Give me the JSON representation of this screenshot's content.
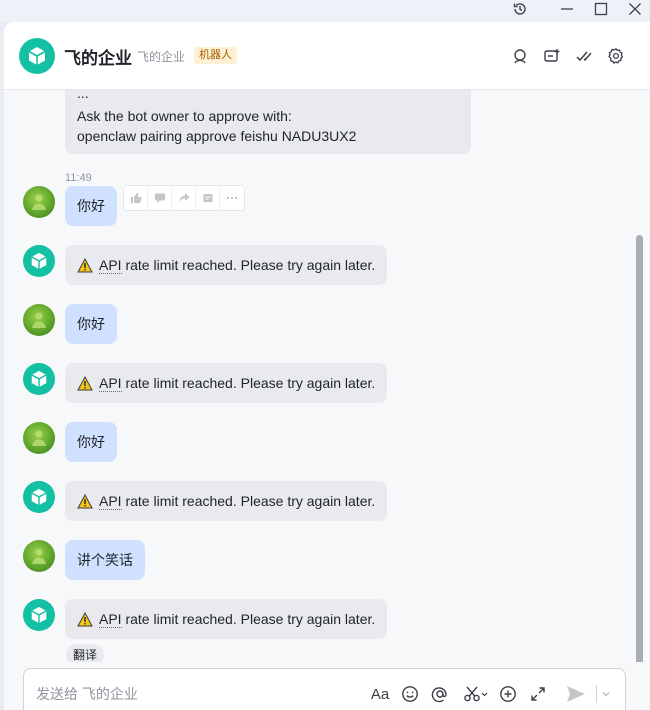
{
  "window": {
    "controls": [
      "history-icon",
      "minimize-icon",
      "maximize-icon",
      "close-icon"
    ]
  },
  "header": {
    "title": "飞的企业",
    "subtitle": "飞的企业",
    "badge": "机器人",
    "icons": [
      "search-chat-icon",
      "add-member-icon",
      "tasks-check-icon",
      "settings-gear-icon"
    ]
  },
  "messages": [
    {
      "sender": "bot",
      "partial_line": "...",
      "lines": [
        "Ask the bot owner to approve with:",
        "openclaw pairing approve feishu NADU3UX2"
      ]
    },
    {
      "sender": "user",
      "time": "11:49",
      "text": "你好"
    },
    {
      "sender": "bot",
      "warn_prefix": "API",
      "text": "rate limit reached. Please try again later."
    },
    {
      "sender": "user",
      "text": "你好"
    },
    {
      "sender": "bot",
      "warn_prefix": "API",
      "text": "rate limit reached. Please try again later."
    },
    {
      "sender": "user",
      "text": "你好"
    },
    {
      "sender": "bot",
      "warn_prefix": "API",
      "text": "rate limit reached. Please try again later."
    },
    {
      "sender": "user",
      "text": "讲个笑话"
    },
    {
      "sender": "bot",
      "warn_prefix": "API",
      "text": "rate limit reached. Please try again later."
    }
  ],
  "message_actions": [
    "thumbs-up-icon",
    "reply-icon",
    "forward-icon",
    "pin-icon",
    "more-icon"
  ],
  "translate_chip": "翻译",
  "composer": {
    "placeholder": "发送给 飞的企业",
    "format_label": "Aa",
    "icons": [
      "text-format-icon",
      "emoji-icon",
      "mention-icon",
      "scissors-icon",
      "add-circle-icon",
      "expand-icon",
      "send-icon",
      "send-options-chevron-icon"
    ]
  },
  "colors": {
    "accent": "#14c0a3",
    "user_bubble": "#cfe1ff",
    "bot_bubble": "#e8eaed",
    "warning": "#f5c518"
  }
}
